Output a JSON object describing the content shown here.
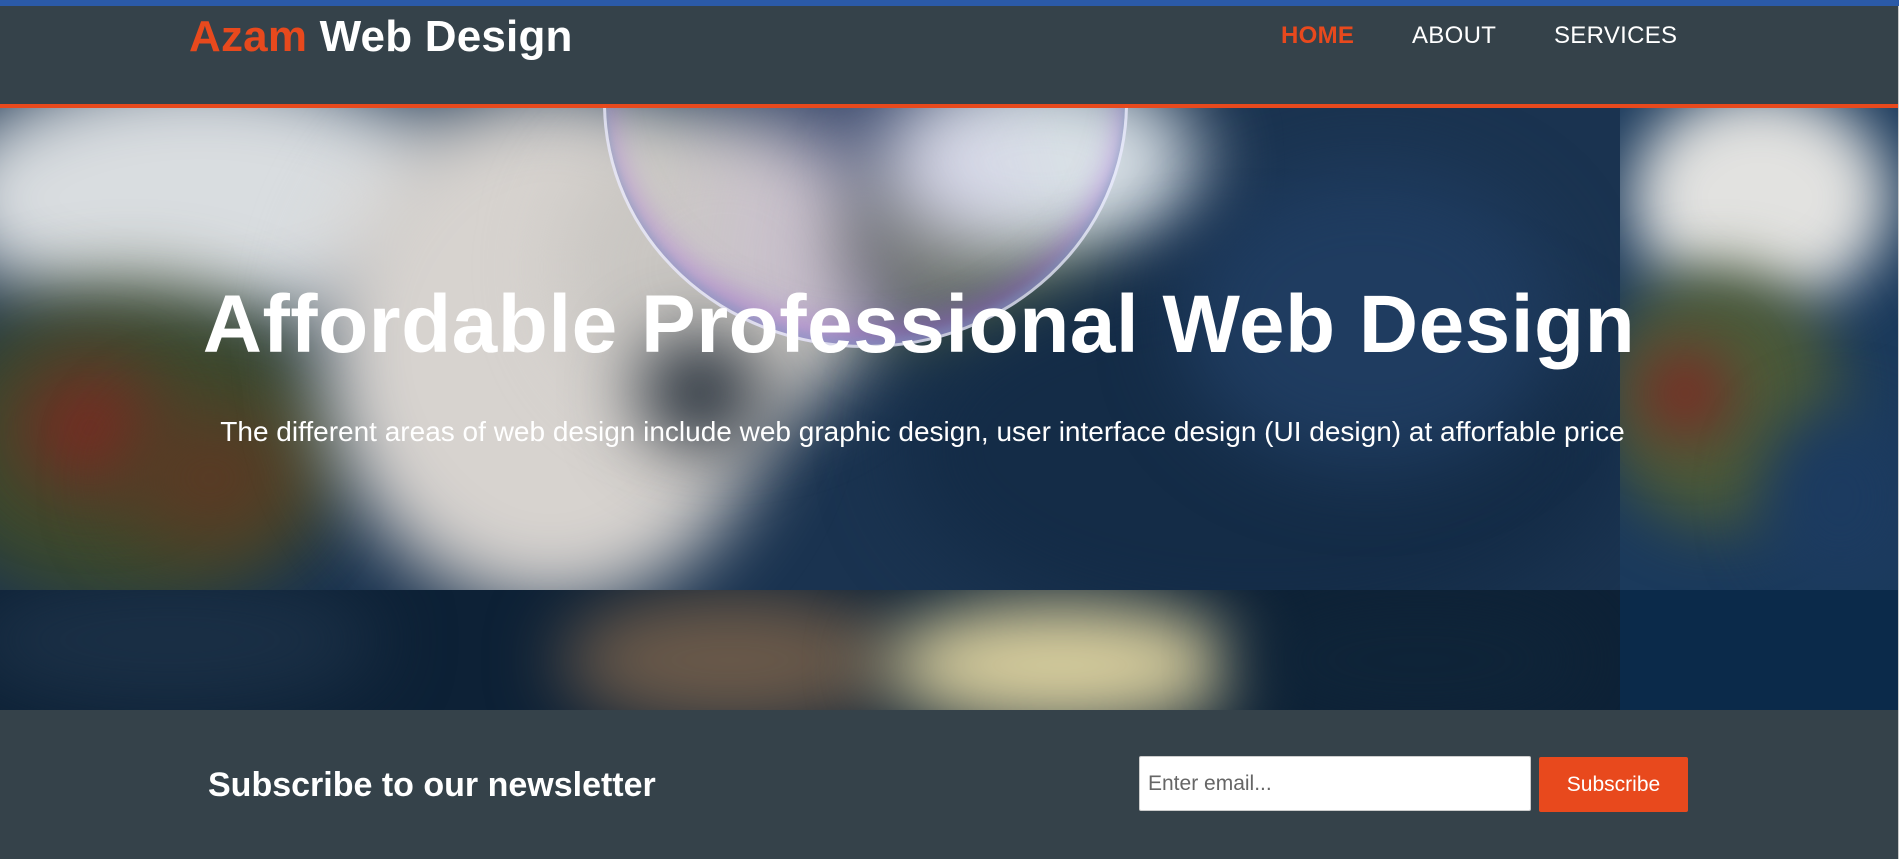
{
  "colors": {
    "header_bg": "#35424a",
    "accent": "#e8491d",
    "text_light": "#ffffff"
  },
  "header": {
    "brand_highlight": "Azam",
    "brand_rest": "Web Design",
    "nav": [
      {
        "label": "HOME",
        "current": true
      },
      {
        "label": "ABOUT",
        "current": false
      },
      {
        "label": "SERVICES",
        "current": false
      }
    ]
  },
  "showcase": {
    "title": "Affordable Professional Web Design",
    "text": "The different areas of web design include web graphic design, user interface design (UI design) at afforfable price"
  },
  "newsletter": {
    "heading": "Subscribe to our newsletter",
    "email_placeholder": "Enter email...",
    "email_value": "",
    "subscribe_label": "Subscribe"
  }
}
